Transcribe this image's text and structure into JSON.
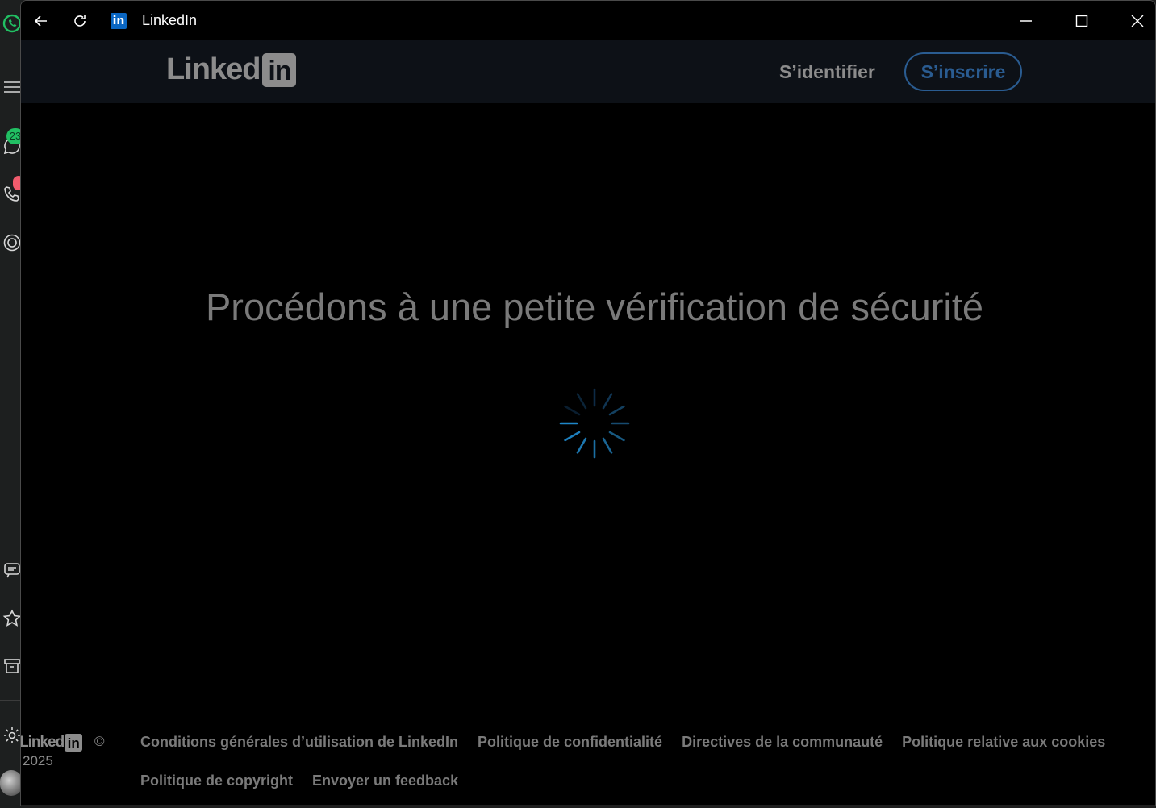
{
  "background_app": {
    "chats_badge": "23"
  },
  "window": {
    "title": "LinkedIn",
    "favicon_text": "in"
  },
  "header": {
    "logo_word": "Linked",
    "logo_box": "in",
    "signin_label": "S’identifier",
    "signup_label": "S’inscrire"
  },
  "main": {
    "heading": "Procédons à une petite vérification de sécurité"
  },
  "footer": {
    "logo_word": "Linked",
    "logo_box": "in",
    "copyright": "©",
    "year": "2025",
    "links": [
      "Conditions générales d’utilisation de LinkedIn",
      "Politique de confidentialité",
      "Directives de la communauté",
      "Politique relative aux cookies",
      "Politique de copyright",
      "Envoyer un feedback"
    ]
  },
  "colors": {
    "accent": "#0a66c2",
    "spinner": "#1b6fb0",
    "whatsapp_green": "#21c063"
  }
}
